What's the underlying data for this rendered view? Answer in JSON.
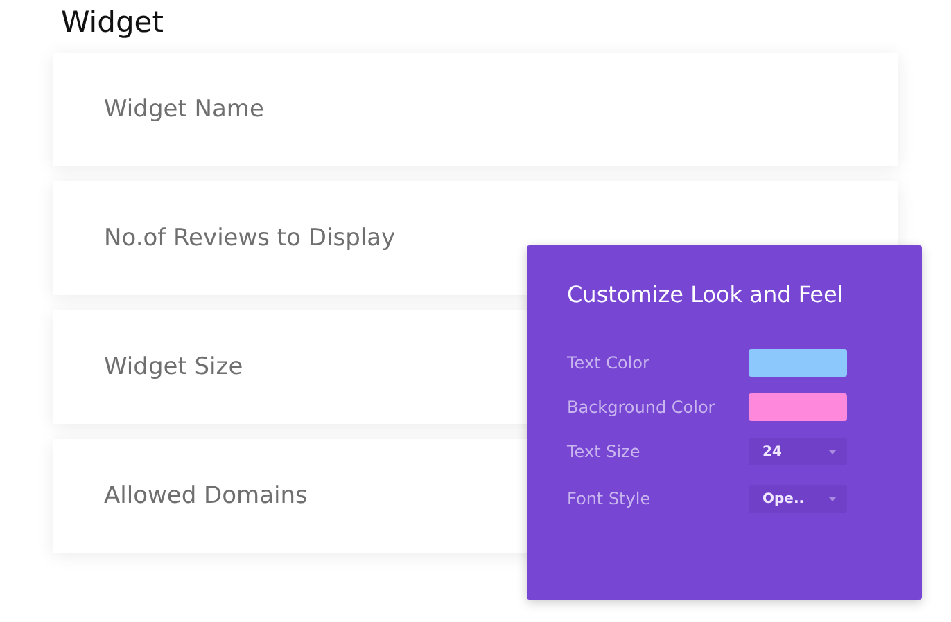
{
  "title": "Widget",
  "fields": [
    {
      "label": "Widget Name"
    },
    {
      "label": "No.of Reviews to Display"
    },
    {
      "label": "Widget Size"
    },
    {
      "label": "Allowed Domains"
    }
  ],
  "panel": {
    "title": "Customize Look and Feel",
    "settings": [
      {
        "kind": "color",
        "label": "Text Color",
        "color": "#8cc8fc"
      },
      {
        "kind": "color",
        "label": "Background Color",
        "color": "#fe88dc"
      },
      {
        "kind": "select",
        "label": "Text Size",
        "value": "24"
      },
      {
        "kind": "select",
        "label": "Font Style",
        "value": "Ope.."
      }
    ]
  }
}
